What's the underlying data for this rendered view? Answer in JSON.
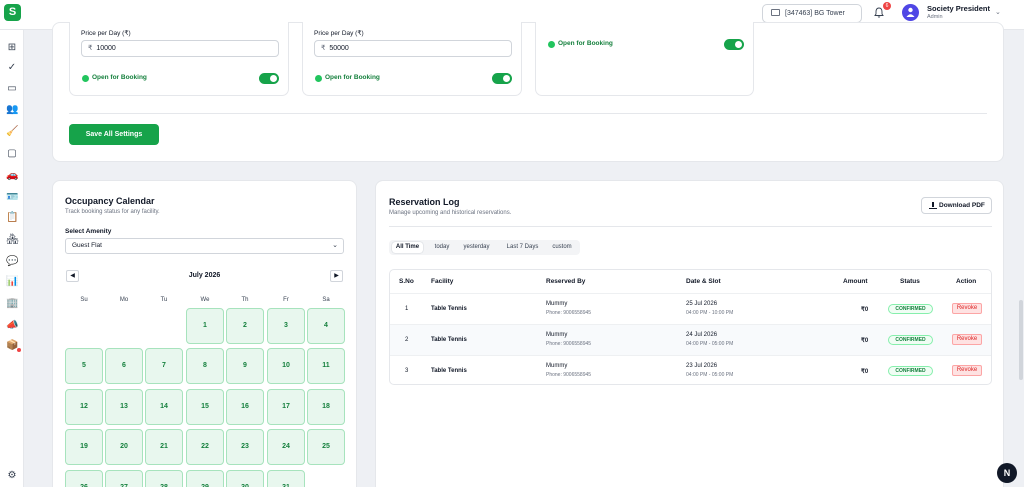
{
  "app": {
    "logo_letter": "S"
  },
  "header": {
    "society": "[347463] BG Tower",
    "notification_count": "6",
    "user_name": "Society President",
    "user_role": "Admin"
  },
  "sidebar": {
    "items": [
      {
        "icon": "grid-icon",
        "glyph": "⊞"
      },
      {
        "icon": "check-icon",
        "glyph": "✓"
      },
      {
        "icon": "monitor-icon",
        "glyph": "▭"
      },
      {
        "icon": "users-icon",
        "glyph": "👥"
      },
      {
        "icon": "broom-icon",
        "glyph": "🧹"
      },
      {
        "icon": "tv-icon",
        "glyph": "▢"
      },
      {
        "icon": "car-icon",
        "glyph": "🚗"
      },
      {
        "icon": "id-card-icon",
        "glyph": "🪪"
      },
      {
        "icon": "clipboard-icon",
        "glyph": "📋"
      },
      {
        "icon": "clubhouse-icon",
        "glyph": "🏘"
      },
      {
        "icon": "chat-icon",
        "glyph": "💬"
      },
      {
        "icon": "chart-icon",
        "glyph": "📊"
      },
      {
        "icon": "building-icon",
        "glyph": "🏢"
      },
      {
        "icon": "megaphone-icon",
        "glyph": "📣"
      },
      {
        "icon": "package-icon",
        "glyph": "📦"
      },
      {
        "icon": "settings-icon",
        "glyph": "⚙"
      }
    ]
  },
  "amenity_settings": {
    "cards": [
      {
        "price_label": "Price per Day (₹)",
        "price": "10000",
        "open_label": "Open for Booking"
      },
      {
        "price_label": "Price per Day (₹)",
        "price": "50000",
        "open_label": "Open for Booking"
      },
      {
        "open_label": "Open for Booking"
      }
    ],
    "currency_symbol": "₹",
    "save_label": "Save All Settings"
  },
  "calendar": {
    "title": "Occupancy Calendar",
    "subtitle": "Track booking status for any facility.",
    "select_label": "Select Amenity",
    "selected_amenity": "Guest Flat",
    "month": "July 2026",
    "prev": "◀",
    "next": "▶",
    "weekdays": [
      "Su",
      "Mo",
      "Tu",
      "We",
      "Th",
      "Fr",
      "Sa"
    ],
    "first_weekday_index": 3,
    "days": [
      "1",
      "2",
      "3",
      "4",
      "5",
      "6",
      "7",
      "8",
      "9",
      "10",
      "11",
      "12",
      "13",
      "14",
      "15",
      "16",
      "17",
      "18",
      "19",
      "20",
      "21",
      "22",
      "23",
      "24",
      "25",
      "26",
      "27",
      "28",
      "29",
      "30",
      "31"
    ]
  },
  "reservations": {
    "title": "Reservation Log",
    "subtitle": "Manage upcoming and historical reservations.",
    "download_label": "Download PDF",
    "filters": [
      "All Time",
      "today",
      "yesterday",
      "Last 7 Days",
      "custom"
    ],
    "active_filter": 0,
    "columns": [
      "S.No",
      "Facility",
      "Reserved By",
      "Date & Slot",
      "Amount",
      "Status",
      "Action"
    ],
    "rows": [
      {
        "sno": "1",
        "facility": "Table Tennis",
        "name": "Mummy",
        "phone": "Phone: 9006558945",
        "date": "25 Jul 2026",
        "slot": "04:00 PM - 10:00 PM",
        "amount": "₹0",
        "status": "CONFIRMED",
        "action": "Revoke"
      },
      {
        "sno": "2",
        "facility": "Table Tennis",
        "name": "Mummy",
        "phone": "Phone: 9006558945",
        "date": "24 Jul 2026",
        "slot": "04:00 PM - 05:00 PM",
        "amount": "₹0",
        "status": "CONFIRMED",
        "action": "Revoke"
      },
      {
        "sno": "3",
        "facility": "Table Tennis",
        "name": "Mummy",
        "phone": "Phone: 9006558945",
        "date": "23 Jul 2026",
        "slot": "04:00 PM - 05:00 PM",
        "amount": "₹0",
        "status": "CONFIRMED",
        "action": "Revoke"
      }
    ]
  },
  "fab_label": "N",
  "colors": {
    "brand": "#16a34a",
    "danger": "#ef4444",
    "accent": "#4f46e5"
  }
}
